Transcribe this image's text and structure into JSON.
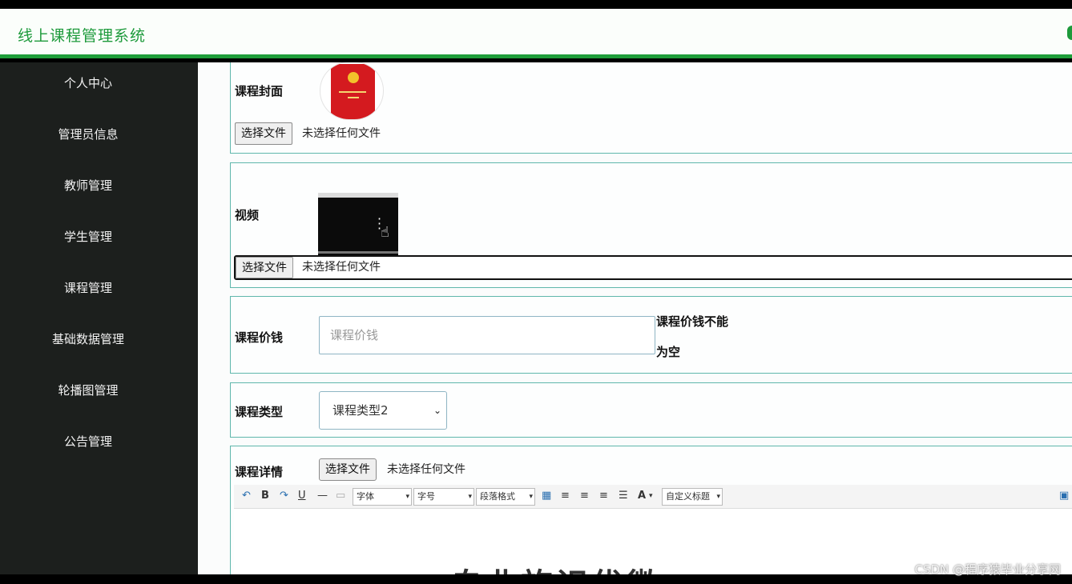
{
  "header": {
    "app_title": "线上课程管理系统"
  },
  "sidebar": {
    "items": [
      {
        "label": "个人中心"
      },
      {
        "label": "管理员信息"
      },
      {
        "label": "教师管理"
      },
      {
        "label": "学生管理"
      },
      {
        "label": "课程管理"
      },
      {
        "label": "基础数据管理"
      },
      {
        "label": "轮播图管理"
      },
      {
        "label": "公告管理"
      }
    ]
  },
  "form": {
    "cover": {
      "label": "课程封面",
      "file_button": "选择文件",
      "file_status": "未选择任何文件"
    },
    "video": {
      "label": "视频",
      "file_button": "选择文件",
      "file_status": "未选择任何文件"
    },
    "price": {
      "label": "课程价钱",
      "placeholder": "课程价钱",
      "error_line1": "课程价钱不能",
      "error_line2": "为空"
    },
    "type": {
      "label": "课程类型",
      "selected": "课程类型2"
    },
    "detail": {
      "label": "课程详情",
      "file_button": "选择文件",
      "file_status": "未选择任何文件",
      "toolbar": {
        "font_family": "字体",
        "font_size": "字号",
        "paragraph": "段落格式",
        "custom_heading": "自定义标题",
        "bold": "B",
        "underline": "U",
        "font_color": "A"
      },
      "content_preview": "自业旅识优微"
    }
  },
  "watermark": "CSDN @程序猿毕业分享网",
  "colors": {
    "accent": "#1e9e3a",
    "sidebar_bg": "#1c1f1d",
    "panel_border": "#5fb7ac"
  }
}
